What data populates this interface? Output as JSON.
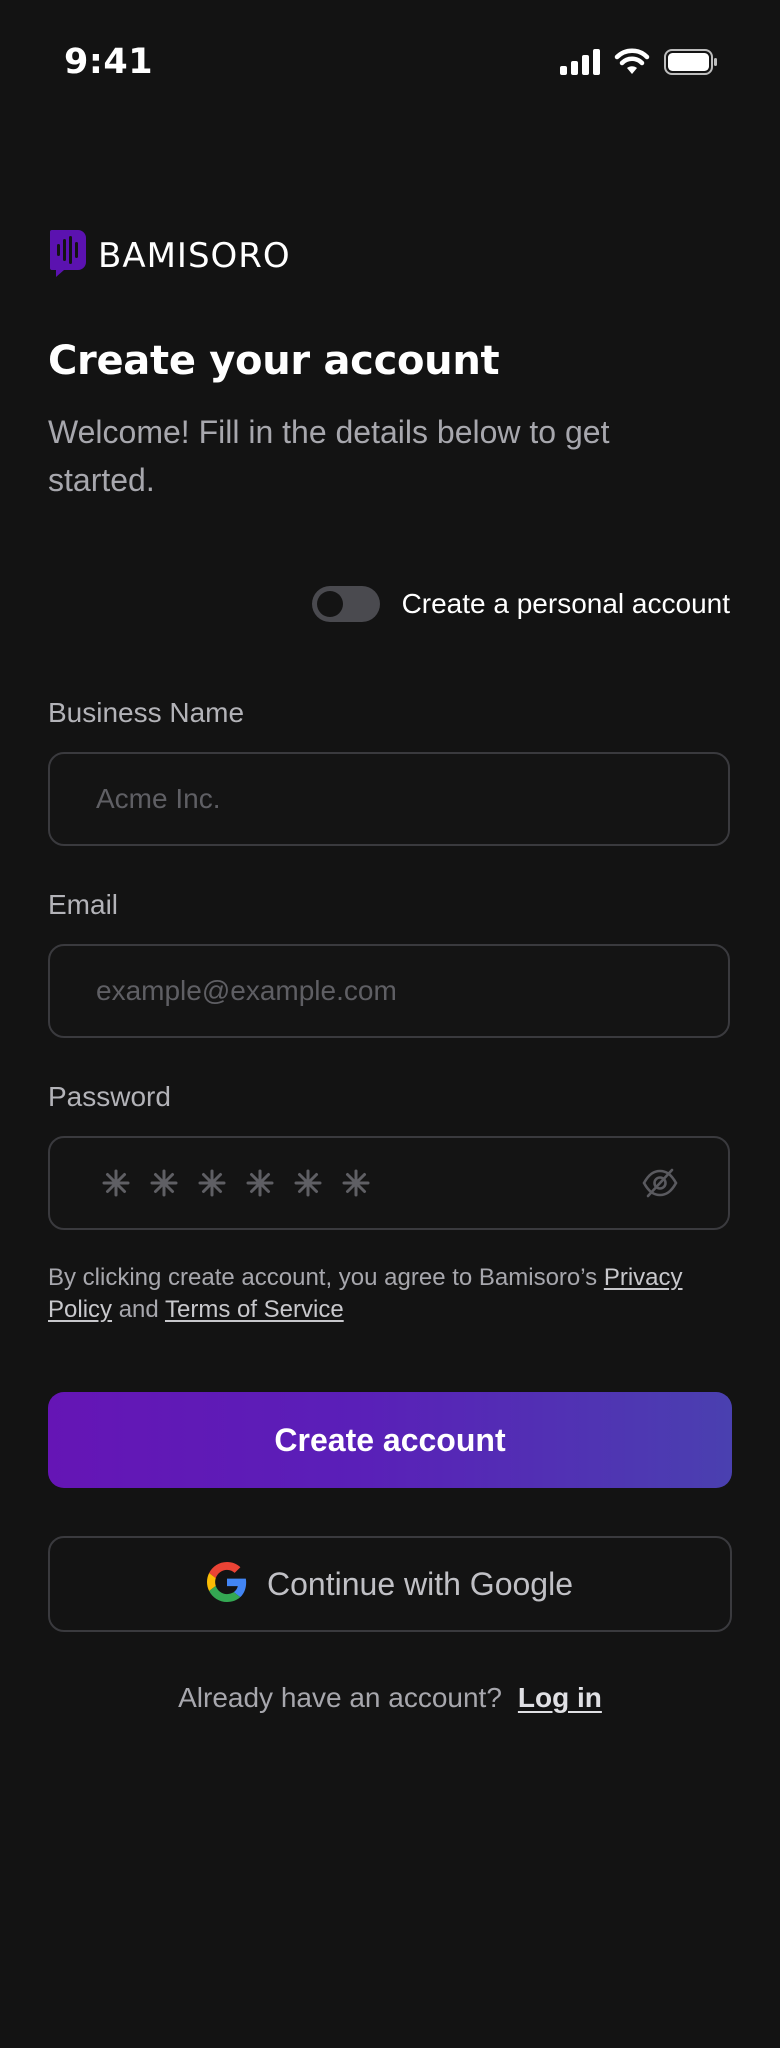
{
  "status_bar": {
    "time": "9:41",
    "icons": [
      "cellular-signal-icon",
      "wifi-icon",
      "battery-icon"
    ]
  },
  "brand": {
    "name": "BAMISORO",
    "logo_icon": "bamisoro-logo-icon",
    "logo_color": "#5b12b0"
  },
  "header": {
    "title": "Create your account",
    "subtitle": "Welcome! Fill in the details below to get started."
  },
  "personal_toggle": {
    "label": "Create a personal account",
    "state": "off"
  },
  "form": {
    "business_name": {
      "label": "Business Name",
      "placeholder": "Acme Inc.",
      "value": ""
    },
    "email": {
      "label": "Email",
      "placeholder": "example@example.com",
      "value": ""
    },
    "password": {
      "label": "Password",
      "placeholder_glyph_count": 6,
      "visibility_icon": "eye-off-icon"
    }
  },
  "terms": {
    "prefix": "By clicking create account, you agree to Bamisoro’s ",
    "privacy_label": "Privacy Policy",
    "joiner": " and ",
    "tos_label": "Terms of Service"
  },
  "actions": {
    "create_label": "Create account",
    "google_label": "Continue with Google",
    "google_icon": "google-icon"
  },
  "footer": {
    "prompt": "Already have an account?",
    "login_label": "Log in"
  },
  "colors": {
    "background": "#131313",
    "accent_start": "#6515b5",
    "accent_end": "#4a40b0",
    "border": "#3a3a3e"
  }
}
